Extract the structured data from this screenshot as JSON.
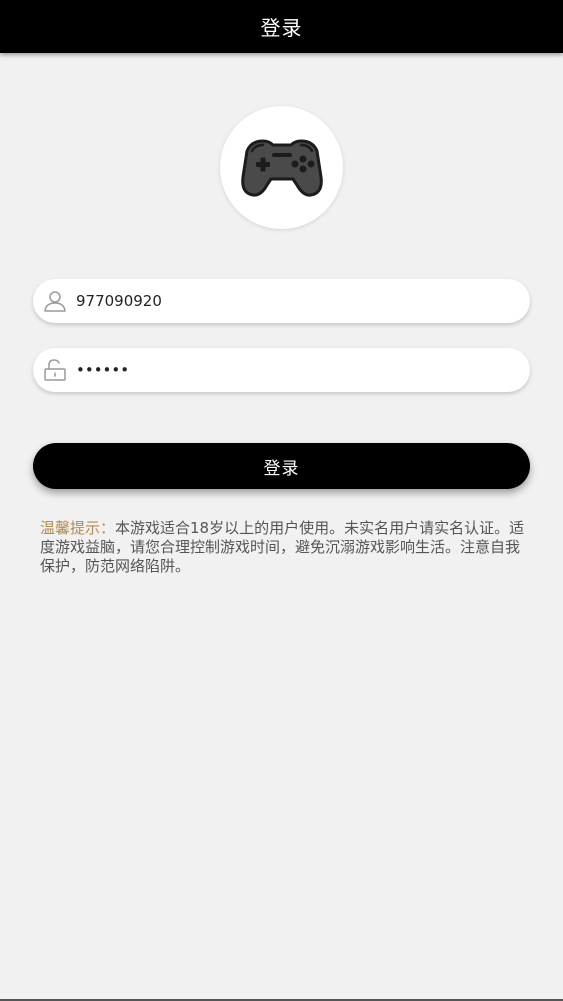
{
  "header": {
    "title": "登录"
  },
  "logo": {
    "icon": "gamepad-icon"
  },
  "form": {
    "username": {
      "value": "977090920",
      "icon": "user-icon"
    },
    "password": {
      "value": "••••••",
      "icon": "unlock-icon"
    },
    "submit_label": "登录"
  },
  "tips": {
    "label": "温馨提示：",
    "text": "本游戏适合18岁以上的用户使用。未实名用户请实名认证。适度游戏益脑，请您合理控制游戏时间，避免沉溺游戏影响生活。注意自我保护，防范网络陷阱。"
  },
  "colors": {
    "header_bg": "#000000",
    "page_bg": "#f1f1f1",
    "tips_label": "#b28a54",
    "button_bg": "#000000"
  }
}
